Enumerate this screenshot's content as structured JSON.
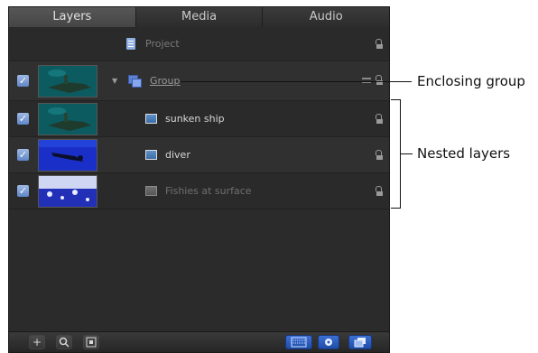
{
  "tabs": [
    {
      "label": "Layers",
      "active": true
    },
    {
      "label": "Media",
      "active": false
    },
    {
      "label": "Audio",
      "active": false
    }
  ],
  "project": {
    "label": "Project",
    "icon": "document-icon"
  },
  "group": {
    "label": "Group",
    "checked": true,
    "expanded": true,
    "icon": "group-icon"
  },
  "layers": [
    {
      "label": "sunken ship",
      "checked": true,
      "icon": "image-icon",
      "dimmed": false
    },
    {
      "label": "diver",
      "checked": true,
      "icon": "image-icon",
      "dimmed": false
    },
    {
      "label": "Fishies at surface",
      "checked": true,
      "icon": "image-icon",
      "dimmed": true
    }
  ],
  "toolbar": {
    "left_buttons": [
      "add-icon",
      "search-icon",
      "frame-icon"
    ],
    "right_buttons": [
      "thumbnail-view-icon",
      "gear-icon",
      "layers-view-icon"
    ],
    "add_label": "+"
  },
  "annotations": {
    "enclosing": "Enclosing group",
    "nested": "Nested layers"
  },
  "colors": {
    "panel_bg": "#2b2b2b",
    "checkbox": "#6f94d4",
    "accent_blue": "#2b5dc0"
  }
}
